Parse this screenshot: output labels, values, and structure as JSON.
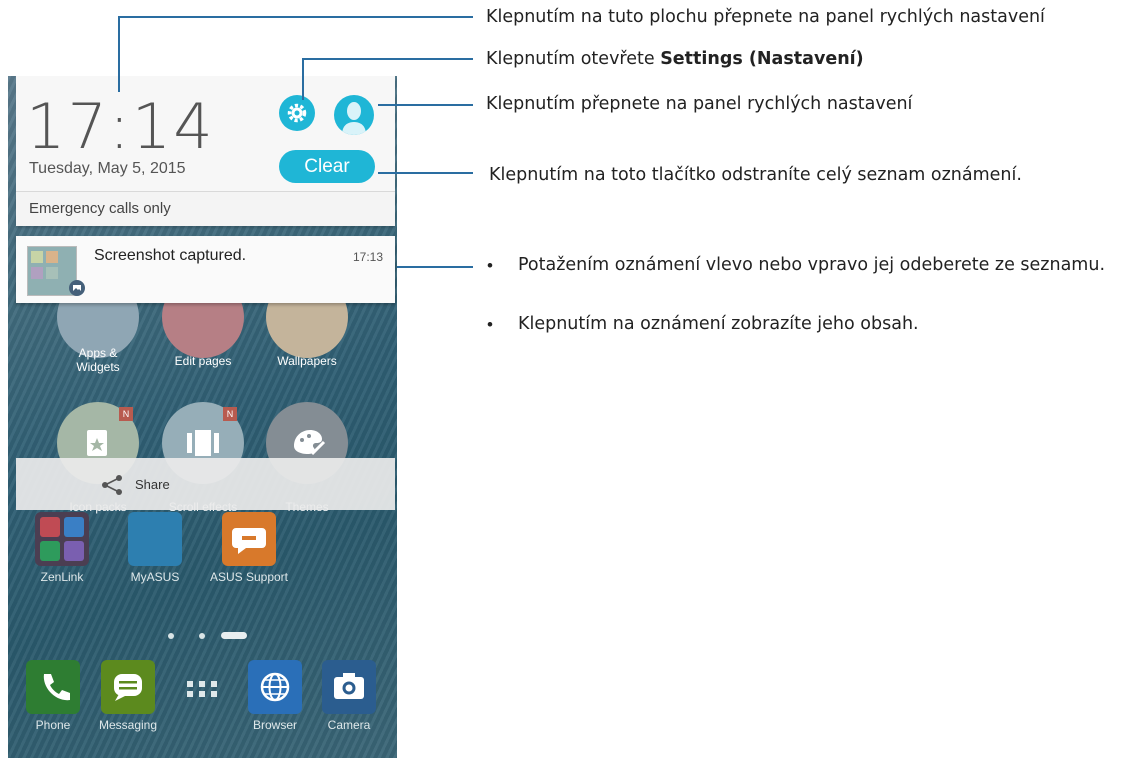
{
  "phone": {
    "time": "17:14",
    "date": "Tuesday, May 5, 2015",
    "clear_label": "Clear",
    "emergency": "Emergency calls only",
    "notification": {
      "title": "Screenshot captured.",
      "time": "17:13"
    },
    "menu": {
      "items": [
        {
          "label_line1": "Apps &",
          "label_line2": "Widgets"
        },
        {
          "label": "Edit pages"
        },
        {
          "label": "Wallpapers"
        },
        {
          "label": "Icon packs",
          "badge": "N"
        },
        {
          "label": "Scroll effects",
          "badge": "N"
        },
        {
          "label": "Themes"
        }
      ],
      "share_label": "Share"
    },
    "home_apps": [
      {
        "label": "ZenLink"
      },
      {
        "label": "MyASUS"
      },
      {
        "label": "ASUS Support"
      }
    ],
    "dock": [
      {
        "label": "Phone"
      },
      {
        "label": "Messaging"
      },
      {
        "label": "Browser"
      },
      {
        "label": "Camera"
      }
    ]
  },
  "callouts": {
    "c1": "Klepnutím na tuto plochu přepnete na panel rychlých nastavení",
    "c2_prefix": "Klepnutím otevřete ",
    "c2_bold": "Settings (Nastavení)",
    "c3": "Klepnutím přepnete na panel rychlých nastavení",
    "c4": "Klepnutím na toto tlačítko odstraníte celý seznam oznámení.",
    "bullets": [
      "Potažením oznámení vlevo nebo vpravo jej odeberete ze seznamu.",
      "Klepnutím na oznámení zobrazíte jeho obsah."
    ]
  },
  "colors": {
    "accent": "#1fb6d6",
    "callout_line": "#2a6da1"
  }
}
